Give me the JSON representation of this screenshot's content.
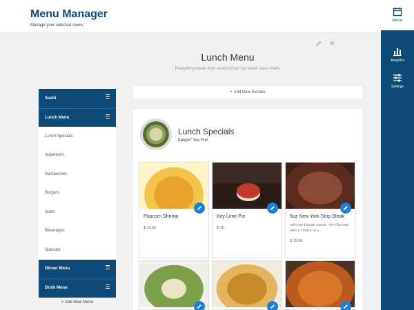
{
  "header": {
    "title": "Menu Manager",
    "subtitle": "Manage your selected menu."
  },
  "rail": {
    "items": [
      {
        "label": "Menus",
        "icon": "calendar-icon",
        "active": true
      },
      {
        "label": "Analytics",
        "icon": "bar-chart-icon",
        "active": false
      },
      {
        "label": "Settings",
        "icon": "sliders-icon",
        "active": false
      }
    ]
  },
  "menu": {
    "title": "Lunch Menu",
    "description": "Everything made from scratch from our world class chefs."
  },
  "sidebar": {
    "items": [
      {
        "label": "Sushi",
        "type": "head"
      },
      {
        "label": "Lunch Menu",
        "type": "head"
      },
      {
        "label": "Lunch Specials",
        "type": "item"
      },
      {
        "label": "Appetizers",
        "type": "item"
      },
      {
        "label": "Sandwiches",
        "type": "item"
      },
      {
        "label": "Burgers",
        "type": "item"
      },
      {
        "label": "Sides",
        "type": "item"
      },
      {
        "label": "Beverages",
        "type": "item"
      },
      {
        "label": "Specials",
        "type": "item"
      },
      {
        "label": "Dinner Menu",
        "type": "head"
      },
      {
        "label": "Drink Menu",
        "type": "head"
      }
    ],
    "add_label": "Add New Menu"
  },
  "add_section_label": "Add New Section",
  "section": {
    "title": "Lunch Specials",
    "subtitle": "Keepin' You Full"
  },
  "cards": [
    {
      "name": "Popcorn Shrimp",
      "desc": "",
      "price": "$ 12.82"
    },
    {
      "name": "Key Lime Pie",
      "desc": "",
      "price": "$ 15"
    },
    {
      "name": "5oz New York Strip Steak",
      "desc": "with our House sauce. <br>Served with a choice of s...",
      "price": "$ 15.99"
    },
    {
      "name": "",
      "desc": "",
      "price": ""
    },
    {
      "name": "",
      "desc": "",
      "price": ""
    },
    {
      "name": "",
      "desc": "",
      "price": ""
    }
  ],
  "colors": {
    "brand": "#0d4a78",
    "accent": "#1c7fd6"
  }
}
